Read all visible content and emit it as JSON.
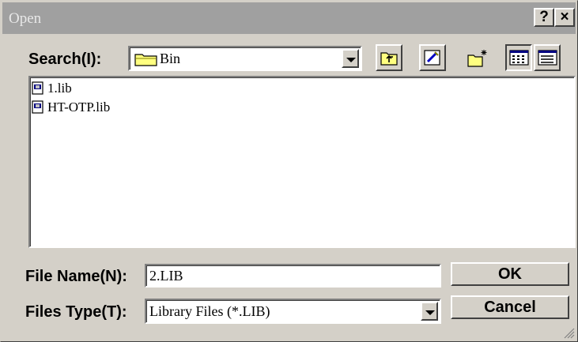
{
  "window": {
    "title": "Open",
    "help_label": "?",
    "close_label": "×"
  },
  "search": {
    "label": "Search(I):",
    "folder": "Bin",
    "toolbar_icons": [
      "up-folder-icon",
      "desktop-icon",
      "new-folder-icon",
      "list-view-icon",
      "details-view-icon"
    ]
  },
  "files": [
    {
      "name": "1.lib",
      "icon": "lib-file-icon"
    },
    {
      "name": "HT-OTP.lib",
      "icon": "lib-file-icon"
    }
  ],
  "filename": {
    "label": "File Name(N):",
    "value": "2.LIB"
  },
  "filetype": {
    "label": "Files Type(T):",
    "value": "Library Files (*.LIB)"
  },
  "buttons": {
    "ok": "OK",
    "cancel": "Cancel"
  },
  "colors": {
    "face": "#d4d0c8",
    "titlebar": "#a0a0a0"
  }
}
